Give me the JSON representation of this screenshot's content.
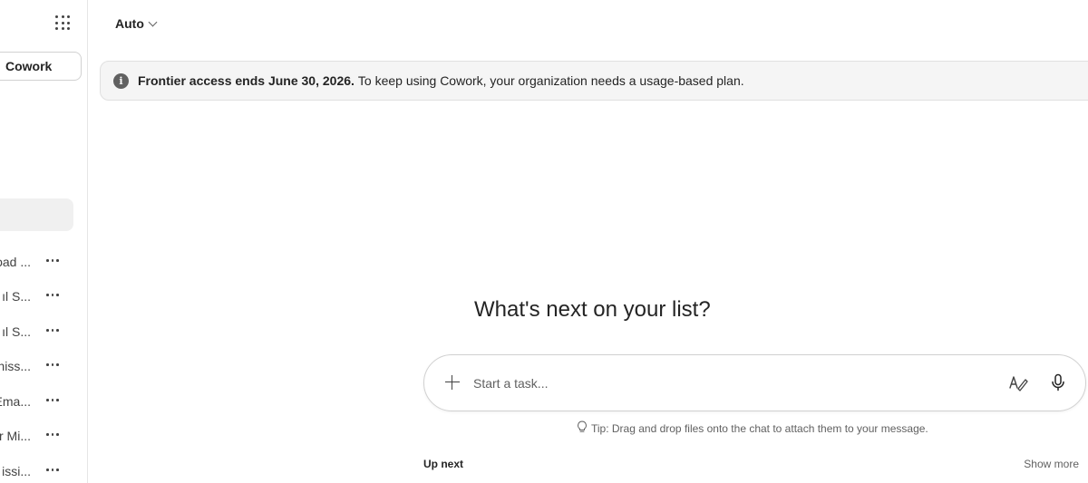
{
  "sidebar": {
    "cowork_label": "Cowork",
    "conversations": [
      {
        "label": "oad ..."
      },
      {
        "label": "ıl S..."
      },
      {
        "label": "ıl S..."
      },
      {
        "label": "niss..."
      },
      {
        "label": "Ema..."
      },
      {
        "label": "r Mi..."
      },
      {
        "label": "issi..."
      }
    ]
  },
  "header": {
    "model": "Auto"
  },
  "banner": {
    "bold": "Frontier access ends June 30, 2026.",
    "rest": "To keep using Cowork, your organization needs a usage-based plan."
  },
  "main": {
    "headline": "What's next on your list?",
    "input_placeholder": "Start a task...",
    "tip": "Tip: Drag and drop files onto the chat to attach them to your message.",
    "up_next": "Up next",
    "show_more": "Show more"
  },
  "icons": {
    "apps": "app-launcher-icon",
    "info": "info-icon",
    "plus": "plus-icon",
    "pen": "pen-icon",
    "mic": "microphone-icon",
    "lightbulb": "lightbulb-icon",
    "more": "more-horizontal-icon"
  }
}
